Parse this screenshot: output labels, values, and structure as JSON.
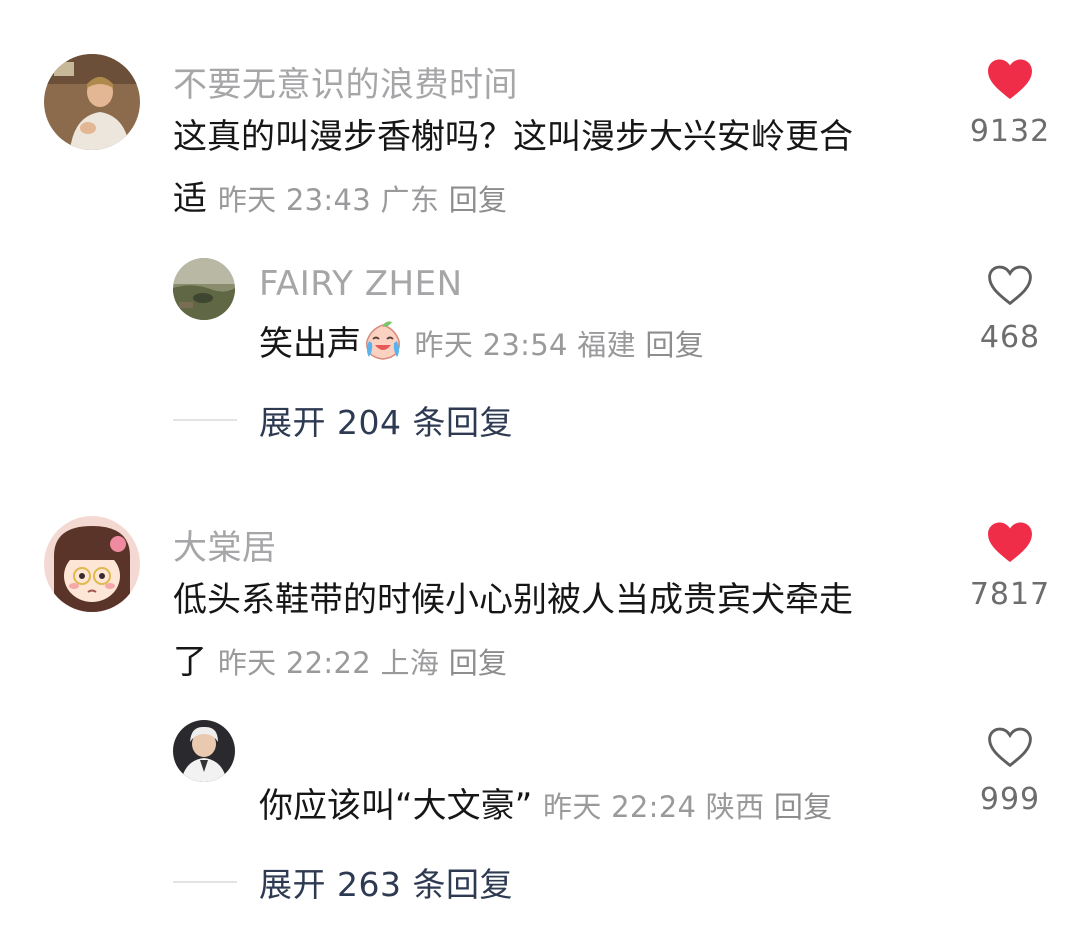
{
  "comments": [
    {
      "username": "不要无意识的浪费时间",
      "text_line1": "这真的叫漫步香榭吗？这叫漫步大兴安岭更合",
      "text_line2": "适",
      "time": "昨天 23:43",
      "location": "广东",
      "reply_label": "回复",
      "likes": "9132",
      "liked": true,
      "avatar_icon": "man-portrait-avatar",
      "replies": [
        {
          "username": "FAIRY ZHEN",
          "text": "笑出声",
          "emoji": "crying-laughing-peach-emoji",
          "time": "昨天 23:54",
          "location": "福建",
          "reply_label": "回复",
          "likes": "468",
          "liked": false,
          "avatar_icon": "landscape-avatar"
        }
      ],
      "expand_label": "展开 204 条回复"
    },
    {
      "username": "大棠居",
      "text_line1": "低头系鞋带的时候小心别被人当成贵宾犬牵走",
      "text_line2": "了",
      "time": "昨天 22:22",
      "location": "上海",
      "reply_label": "回复",
      "likes": "7817",
      "liked": true,
      "avatar_icon": "cartoon-girl-avatar",
      "replies": [
        {
          "username": "",
          "text": "你应该叫“大文豪”",
          "time": "昨天 22:24",
          "location": "陕西",
          "reply_label": "回复",
          "likes": "999",
          "liked": false,
          "avatar_icon": "white-hair-man-avatar"
        }
      ],
      "expand_label": "展开 263 条回复"
    }
  ],
  "colors": {
    "like_active": "#ef2d48",
    "like_inactive": "#5f5f5f",
    "username": "#a6a6a8",
    "meta": "#9a9a9c",
    "expand": "#2e3a52"
  }
}
